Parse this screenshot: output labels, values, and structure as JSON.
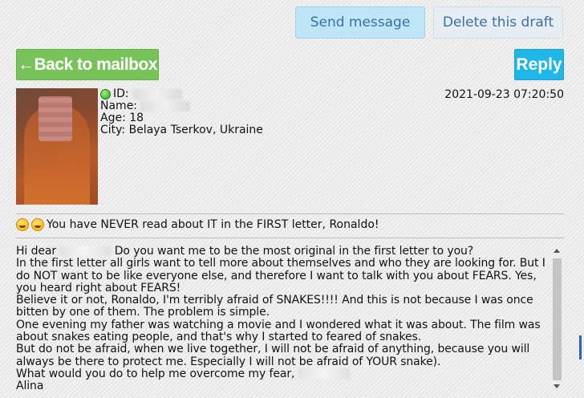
{
  "toolbar": {
    "send_label": "Send message",
    "delete_label": "Delete this draft",
    "back_label": "←Back to mailbox",
    "reply_label": "Reply"
  },
  "profile": {
    "id_label": "ID:",
    "name_label": "Name:",
    "age_label": "Age: 18",
    "city_label": "City: Belaya Tserkov, Ukraine",
    "status": "online",
    "status_color": "#2fa21f"
  },
  "message": {
    "date": "2021-09-23 07:20:50",
    "subject": "You have NEVER read about IT in the FIRST letter, Ronaldo!",
    "greeting_start": "Hi dear",
    "greeting_rest": " Do you want me to be the most original in the first letter to you?",
    "paragraphs": [
      "In the first letter all girls want to tell more about themselves and who they are looking for. But I do NOT want to be like everyone else, and therefore I want to talk with you about FEARS. Yes, you heard right about FEARS!",
      "Believe it or not, Ronaldo, I'm terribly afraid of SNAKES!!!! And this is not because I was once bitten by one of them. The problem is simple.",
      "One evening my father was watching a movie and I wondered what it was about. The film was about snakes eating people, and that's why I started to feared of snakes.",
      "But do not be afraid, when we live together, I will not be afraid of anything, because you will always be there to protect me. Especially I will not be afraid of YOUR snake)."
    ],
    "closing_question": "What would you do to help me overcome my fear,",
    "signature": "Alina"
  },
  "colors": {
    "back_button": "#78c25a",
    "reply_button": "#1fb6e8",
    "send_button": "#bfe6f7",
    "delete_button": "#e6eef3",
    "link_text": "#3a6fa8"
  },
  "icons": [
    "online-status-icon",
    "rofl-emoji-icon",
    "yum-emoji-icon",
    "scroll-up-arrow-icon",
    "scroll-down-arrow-icon"
  ]
}
